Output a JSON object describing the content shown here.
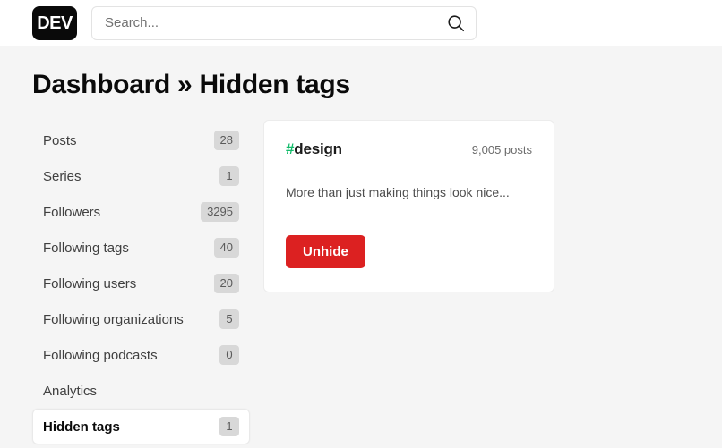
{
  "header": {
    "logo_text": "DEV",
    "search_placeholder": "Search...",
    "search_value": "",
    "search_icon": "search-icon"
  },
  "page": {
    "title": "Dashboard » Hidden tags"
  },
  "sidebar": {
    "items": [
      {
        "label": "Posts",
        "count": "28",
        "active": false
      },
      {
        "label": "Series",
        "count": "1",
        "active": false
      },
      {
        "label": "Followers",
        "count": "3295",
        "active": false
      },
      {
        "label": "Following tags",
        "count": "40",
        "active": false
      },
      {
        "label": "Following users",
        "count": "20",
        "active": false
      },
      {
        "label": "Following organizations",
        "count": "5",
        "active": false
      },
      {
        "label": "Following podcasts",
        "count": "0",
        "active": false
      },
      {
        "label": "Analytics",
        "count": "",
        "active": false
      },
      {
        "label": "Hidden tags",
        "count": "1",
        "active": true
      }
    ]
  },
  "main": {
    "tag_card": {
      "hash": "#",
      "name": "design",
      "post_count": "9,005 posts",
      "description": "More than just making things look nice...",
      "action_label": "Unhide"
    }
  },
  "colors": {
    "page_background": "#f5f5f5",
    "tag_accent": "#12bb6a",
    "unhide_button": "#dc2121",
    "badge_background": "#d8d8d8",
    "logo_background": "#0a0a0a"
  }
}
